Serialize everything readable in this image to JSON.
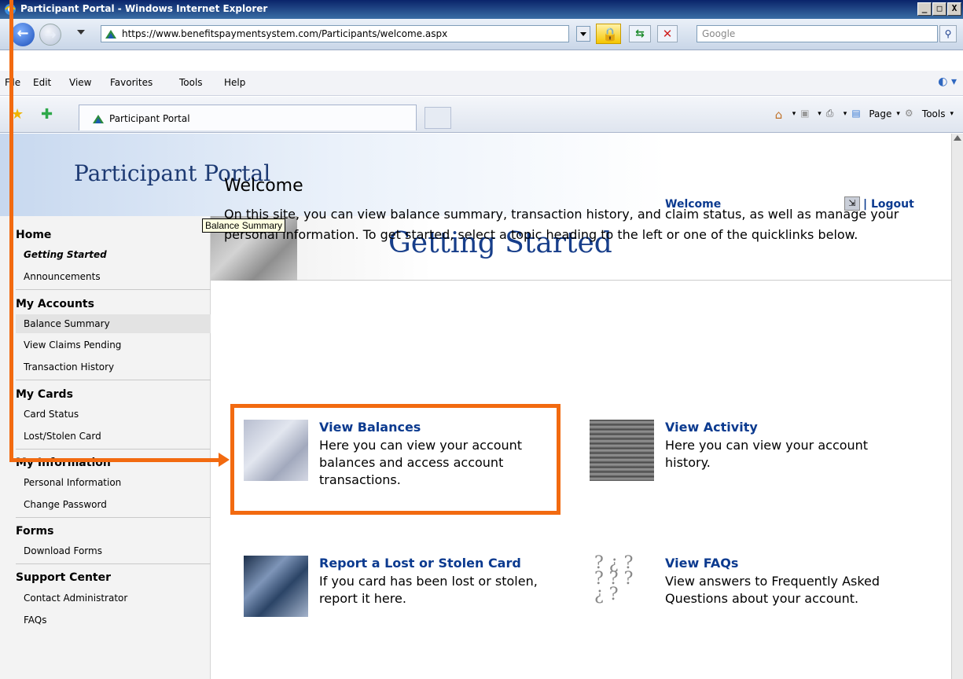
{
  "window": {
    "title": "Participant Portal - Windows Internet Explorer",
    "controls": [
      "_",
      "□",
      "X"
    ]
  },
  "address": {
    "url": "https://www.benefitspaymentsystem.com/Participants/welcome.aspx",
    "search_placeholder": "Google"
  },
  "menu": [
    "File",
    "Edit",
    "View",
    "Favorites",
    "Tools",
    "Help"
  ],
  "tabs": [
    {
      "label": "Participant Portal"
    }
  ],
  "commandbar": {
    "page_label": "Page",
    "tools_label": "Tools"
  },
  "header": {
    "portal_title": "Participant Portal",
    "welcome_label": "Welcome",
    "logout_label": "| Logout"
  },
  "nav": {
    "home": {
      "heading": "Home",
      "items": [
        "Getting Started",
        "Announcements"
      ]
    },
    "accounts": {
      "heading": "My Accounts",
      "items": [
        "Balance Summary",
        "View Claims Pending",
        "Transaction History"
      ]
    },
    "cards": {
      "heading": "My Cards",
      "items": [
        "Card Status",
        "Lost/Stolen Card"
      ]
    },
    "info": {
      "heading": "My Information",
      "items": [
        "Personal Information",
        "Change Password"
      ]
    },
    "forms": {
      "heading": "Forms",
      "items": [
        "Download Forms"
      ]
    },
    "support": {
      "heading": "Support Center",
      "items": [
        "Contact Administrator",
        "FAQs"
      ]
    }
  },
  "tooltip": "Balance Summary",
  "main": {
    "banner_title": "Getting Started",
    "heading": "Welcome",
    "intro": "On this site, you can view balance summary, transaction history, and claim status, as well as manage your personal information. To get started, select a topic heading to the left or one of the quicklinks below.",
    "quicklinks": [
      {
        "title": "View Balances",
        "desc": "Here you can view your account balances and access account transactions."
      },
      {
        "title": "View Activity",
        "desc": "Here you can view your account history."
      },
      {
        "title": "Report a Lost or Stolen Card",
        "desc": "If you card has been lost or stolen, report it here."
      },
      {
        "title": "View FAQs",
        "desc": "View answers to Frequently Asked Questions about your account."
      }
    ]
  },
  "colors": {
    "accent": "#0b3a8f",
    "annotation": "#f26a10"
  }
}
